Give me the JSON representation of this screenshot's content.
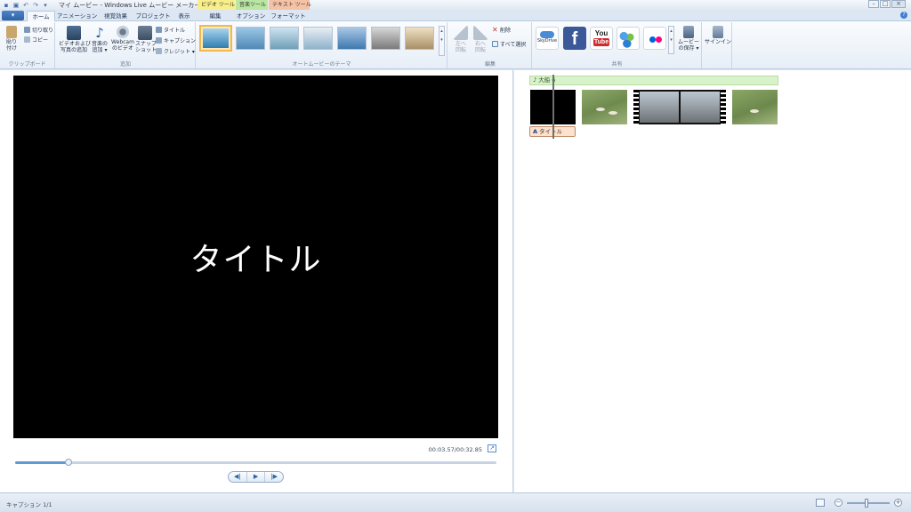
{
  "window": {
    "title": "マイ ムービー - Windows Live ムービー メーカー",
    "contextual_tabs": [
      "ビデオ ツール",
      "音楽ツール",
      "テキスト ツール"
    ],
    "controls": [
      "–",
      "□",
      "×"
    ]
  },
  "tabs": {
    "file": "▾",
    "items": [
      "ホーム",
      "アニメーション",
      "視覚効果",
      "プロジェクト",
      "表示",
      "編集",
      "オプション",
      "フォーマット"
    ],
    "active": "ホーム",
    "help": "?"
  },
  "ribbon": {
    "clipboard": {
      "label": "クリップボード",
      "paste": [
        "貼り",
        "付け"
      ],
      "cut": "切り取り",
      "copy": "コピー"
    },
    "add": {
      "label": "追加",
      "add_video": [
        "ビデオおよび",
        "写真の追加"
      ],
      "add_music": [
        "音楽の",
        "追加 ▾"
      ],
      "webcam": [
        "Webcam",
        "のビデオ"
      ],
      "snapshot": [
        "スナップ",
        "ショット"
      ],
      "title": "タイトル",
      "caption": "キャプション",
      "credits": "クレジット ▾"
    },
    "themes": {
      "label": "オートムービーのテーマ"
    },
    "edit": {
      "label": "編集",
      "rotate_left": [
        "左へ",
        "回転"
      ],
      "rotate_right": [
        "右へ",
        "回転"
      ],
      "delete": "削除",
      "select_all": "すべて選択"
    },
    "share": {
      "label": "共有",
      "skydrive": "SkyDrive",
      "facebook": "f",
      "youtube": [
        "You",
        "Tube"
      ],
      "save_movie": [
        "ムービー",
        "の保存 ▾"
      ]
    },
    "signin": {
      "label": "サインイン"
    }
  },
  "preview": {
    "title_text": "タイトル",
    "time": "00:03.57/00:32.85",
    "progress": 0.11,
    "buttons": [
      "◀|",
      "▶",
      "|▶"
    ]
  },
  "storyboard": {
    "music_label": "♪ 大船 6",
    "caption_chip": "タイトル",
    "caption_icon": "A"
  },
  "status": {
    "text": "キャプション 1/1",
    "zoom_out": "−",
    "zoom_in": "+",
    "zoom_level": 0.45
  },
  "colors": {
    "accent": "#2f62a8",
    "video_tools": "#f8ee8a",
    "music_tools": "#b9e6a2",
    "text_tools": "#f6c2a6",
    "music_track": "#d8f3c9"
  }
}
